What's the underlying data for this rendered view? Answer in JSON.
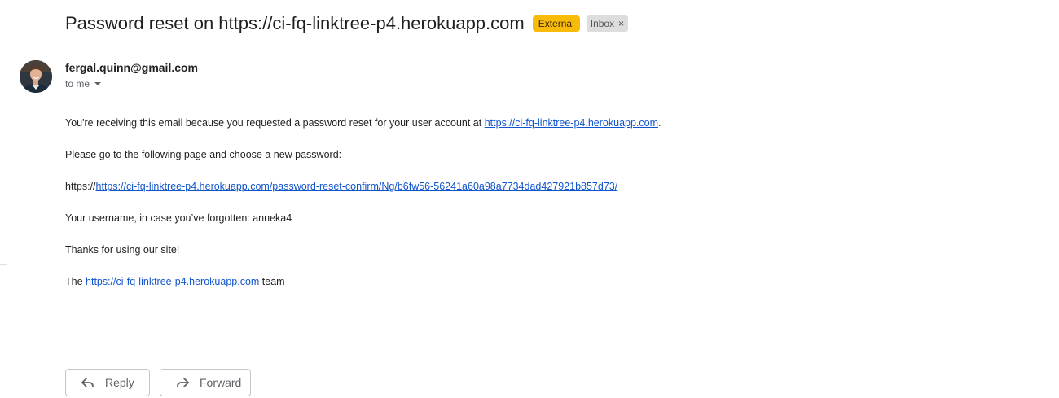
{
  "email": {
    "subject": "Password reset on https://ci-fq-linktree-p4.herokuapp.com",
    "labels": {
      "external": "External",
      "inbox": "Inbox",
      "inbox_remove": "×"
    },
    "sender": "fergal.quinn@gmail.com",
    "recipient": "to me",
    "body": {
      "line1_prefix": "You're receiving this email because you requested a password reset for your user account at ",
      "line1_link": "https://ci-fq-linktree-p4.herokuapp.com",
      "line1_suffix": ".",
      "line2": "Please go to the following page and choose a new password:",
      "line3_prefix": "https://",
      "line3_link": "https://ci-fq-linktree-p4.herokuapp.com/password-reset-confirm/Ng/b6fw56-56241a60a98a7734dad427921b857d73/",
      "line4": "Your username, in case you’ve forgotten: anneka4",
      "line5": "Thanks for using our site!",
      "line6_prefix": "The ",
      "line6_link": "https://ci-fq-linktree-p4.herokuapp.com",
      "line6_suffix": " team"
    }
  },
  "actions": {
    "reply_label": "Reply",
    "forward_label": "Forward"
  },
  "colors": {
    "external_label": "#f9bb09",
    "link": "#1155cc"
  },
  "icons": {
    "avatar": "profile-photo",
    "recipient_caret": "caret-down-icon",
    "reply": "reply-icon",
    "forward": "forward-icon"
  }
}
